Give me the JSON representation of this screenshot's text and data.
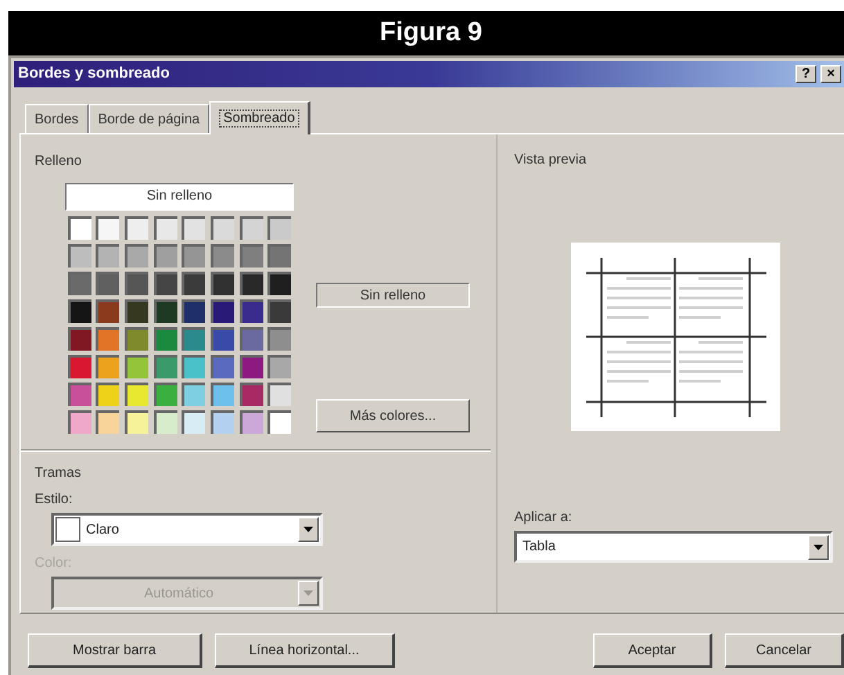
{
  "figure_title": "Figura 9",
  "window": {
    "title": "Bordes y sombreado",
    "title_buttons": [
      "?",
      "×"
    ]
  },
  "tabs": [
    {
      "label": "Bordes",
      "selected": false
    },
    {
      "label": "Borde de página",
      "selected": false
    },
    {
      "label": "Sombreado",
      "selected": true
    }
  ],
  "fill": {
    "label": "Relleno",
    "no_fill_button": "Sin relleno",
    "current": "Sin relleno",
    "more_colors_button": "Más colores...",
    "palette": [
      {
        "color": "#ffffff"
      },
      {
        "color": "#f6f6f6"
      },
      {
        "color": "#eeeeee"
      },
      {
        "color": "#e8e8e8"
      },
      {
        "color": "#e2e2e2"
      },
      {
        "color": "#dadada"
      },
      {
        "color": "#d4d4d4"
      },
      {
        "color": "#cacaca"
      },
      {
        "color": "#bdbdbd"
      },
      {
        "color": "#b3b3b3"
      },
      {
        "color": "#a9a9a9"
      },
      {
        "color": "#9f9f9f"
      },
      {
        "color": "#959595"
      },
      {
        "color": "#8b8b8b"
      },
      {
        "color": "#7f7f7f"
      },
      {
        "color": "#747474"
      },
      {
        "color": "#6a6a6a"
      },
      {
        "color": "#606060"
      },
      {
        "color": "#565656"
      },
      {
        "color": "#454545"
      },
      {
        "color": "#3b3b3b"
      },
      {
        "color": "#313131"
      },
      {
        "color": "#292929"
      },
      {
        "color": "#1f1f1f"
      },
      {
        "color": "#151515"
      },
      {
        "color": "#8c3a1e"
      },
      {
        "color": "#36391f"
      },
      {
        "color": "#1f3a22"
      },
      {
        "color": "#1f2f6a"
      },
      {
        "color": "#2a1a78"
      },
      {
        "color": "#3a2c8c"
      },
      {
        "color": "#3a3a3a"
      },
      {
        "color": "#801824"
      },
      {
        "color": "#e27428"
      },
      {
        "color": "#7f8a2c"
      },
      {
        "color": "#1a8a3e"
      },
      {
        "color": "#2a8a8c"
      },
      {
        "color": "#3a4aa8"
      },
      {
        "color": "#6a6aa0"
      },
      {
        "color": "#8e8e8e"
      },
      {
        "color": "#d81830"
      },
      {
        "color": "#eda21e"
      },
      {
        "color": "#94c43a"
      },
      {
        "color": "#3a9a6a"
      },
      {
        "color": "#4ac0c8"
      },
      {
        "color": "#5a6abf"
      },
      {
        "color": "#8c1a80"
      },
      {
        "color": "#a8a8a8"
      },
      {
        "color": "#c8509a"
      },
      {
        "color": "#eed21a"
      },
      {
        "color": "#e8e830"
      },
      {
        "color": "#3ab040"
      },
      {
        "color": "#7ed0e0"
      },
      {
        "color": "#6ec0ec"
      },
      {
        "color": "#a82a64"
      },
      {
        "color": "#e0e0e0"
      },
      {
        "color": "#f0a8c8"
      },
      {
        "color": "#f8d49a"
      },
      {
        "color": "#f6f29a"
      },
      {
        "color": "#d6ecca"
      },
      {
        "color": "#d8ecf6"
      },
      {
        "color": "#b4d0f0"
      },
      {
        "color": "#cca8d8"
      },
      {
        "color": "#ffffff"
      }
    ]
  },
  "patterns": {
    "label": "Tramas",
    "style": {
      "label": "Estilo:",
      "value": "Claro",
      "disabled": false
    },
    "color": {
      "label": "Color:",
      "value": "Automático",
      "disabled": true
    }
  },
  "preview": {
    "label": "Vista previa"
  },
  "apply_to": {
    "label": "Aplicar a:",
    "value": "Tabla"
  },
  "buttons": [
    {
      "label": "Mostrar barra",
      "kind": "left"
    },
    {
      "label": "Línea horizontal...",
      "kind": "left"
    },
    {
      "label": "Aceptar",
      "kind": "right"
    },
    {
      "label": "Cancelar",
      "kind": "right"
    }
  ]
}
